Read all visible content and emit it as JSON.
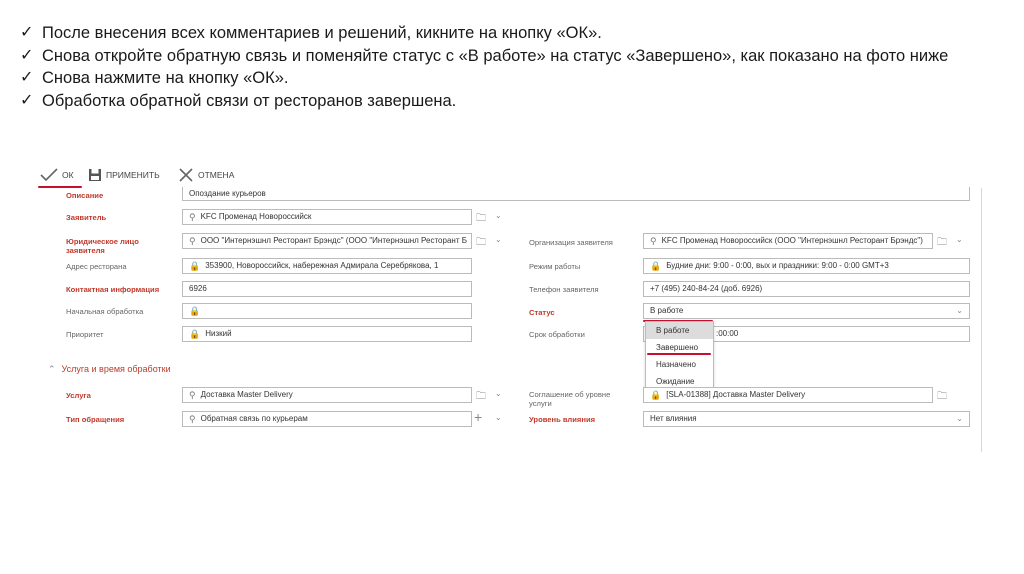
{
  "instructions": [
    {
      "check": "✓",
      "text": "После внесения всех комментариев и решений, кикните на кнопку «ОК»."
    },
    {
      "check": "✓",
      "text": "Снова откройте обратную связь и поменяйте статус с «В работе» на статус «Завершено», как показано на фото ниже"
    },
    {
      "check": "✓",
      "text": "Снова нажмите на кнопку «ОК»."
    },
    {
      "check": "✓",
      "text": "Обработка обратной связи от ресторанов завершена."
    }
  ],
  "toolbar": {
    "ok_label": "ОК",
    "apply_label": "ПРИМЕНИТЬ",
    "cancel_label": "ОТМЕНА"
  },
  "form": {
    "description": {
      "label": "Описание",
      "value": "Опоздание курьеров"
    },
    "applicant": {
      "label": "Заявитель",
      "value": "KFC Променад Новороссийск"
    },
    "legal_entity": {
      "label": "Юридическое лицо заявителя",
      "value": "ООО \"Интернэшнл Ресторант Брэндс\" (ООО \"Интернэшнл Ресторант Б"
    },
    "restaurant_address": {
      "label": "Адрес ресторана",
      "value": "353900, Новороссийск, набережная Адмирала Серебрякова, 1"
    },
    "contact_info": {
      "label": "Контактная информация",
      "value": "6926"
    },
    "initial_processing": {
      "label": "Начальная обработка",
      "value": ""
    },
    "priority": {
      "label": "Приоритет",
      "value": "Низкий"
    },
    "applicant_org": {
      "label": "Организация заявителя",
      "value": "KFC Променад Новороссийск (ООО \"Интернэшнл Ресторант Брэндс\")"
    },
    "work_mode": {
      "label": "Режим работы",
      "value": "Будние дни: 9:00 - 0:00, вых и праздники: 9:00 - 0:00   GMT+3"
    },
    "applicant_phone": {
      "label": "Телефон заявителя",
      "value": "+7 (495) 240-84-24 (доб. 6926)"
    },
    "status": {
      "label": "Статус",
      "value": "В работе"
    },
    "processing_deadline": {
      "label": "Срок обработки",
      "value": ":00:00"
    },
    "section_title": "Услуга и время обработки",
    "service": {
      "label": "Услуга",
      "value": "Доставка Master Delivery"
    },
    "request_type": {
      "label": "Тип обращения",
      "value": "Обратная связь по курьерам"
    },
    "sla": {
      "label": "Соглашение об уровне услуги",
      "value": "[SLA-01388] Доставка Master Delivery"
    },
    "impact_level": {
      "label": "Уровень влияния",
      "value": "Нет влияния"
    }
  },
  "status_options": [
    "В работе",
    "Завершено",
    "Назначено",
    "Ожидание"
  ],
  "colors": {
    "accent_red": "#c8102e",
    "required_label": "#c0392b"
  }
}
